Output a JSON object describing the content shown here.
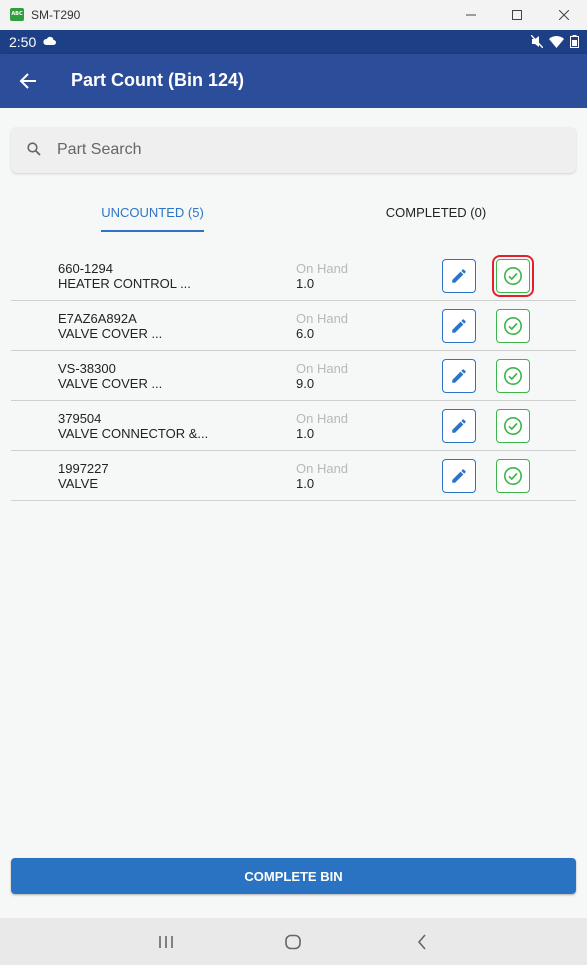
{
  "window": {
    "title": "SM-T290",
    "icon_text": "ABC"
  },
  "status_bar": {
    "time": "2:50"
  },
  "app_bar": {
    "title": "Part Count (Bin 124)"
  },
  "search": {
    "placeholder": "Part Search",
    "value": ""
  },
  "tabs": [
    {
      "label": "UNCOUNTED (5)",
      "active": true
    },
    {
      "label": "COMPLETED (0)",
      "active": false
    }
  ],
  "parts": [
    {
      "number": "660-1294",
      "description": "HEATER CONTROL ...",
      "onhand_label": "On Hand",
      "onhand": "1.0"
    },
    {
      "number": "E7AZ6A892A",
      "description": "VALVE COVER ...",
      "onhand_label": "On Hand",
      "onhand": "6.0"
    },
    {
      "number": "VS-38300",
      "description": "VALVE COVER ...",
      "onhand_label": "On Hand",
      "onhand": "9.0"
    },
    {
      "number": "379504",
      "description": "VALVE CONNECTOR &...",
      "onhand_label": "On Hand",
      "onhand": "1.0"
    },
    {
      "number": "1997227",
      "description": "VALVE",
      "onhand_label": "On Hand",
      "onhand": "1.0"
    }
  ],
  "complete_button": {
    "label": "COMPLETE BIN"
  },
  "colors": {
    "app_bar": "#2b4d9a",
    "status_bar": "#1d3f85",
    "accent_blue": "#2d74c4",
    "accent_green": "#3bb54a",
    "highlight_red": "#e3212b"
  }
}
